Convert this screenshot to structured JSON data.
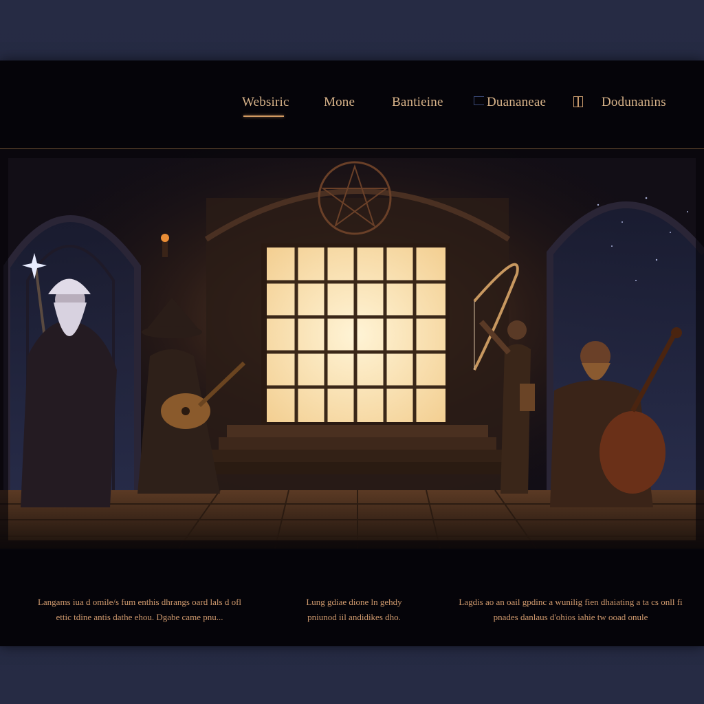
{
  "nav": {
    "items": [
      {
        "label": "Websiric",
        "active": true
      },
      {
        "label": "Mone",
        "active": false
      },
      {
        "label": "Bantieine",
        "active": false
      },
      {
        "label": "Duananeae",
        "active": false
      },
      {
        "label": "Dodunanins",
        "active": false
      }
    ]
  },
  "hero": {
    "scene": "tavern-band-illustration"
  },
  "content": {
    "columns": [
      {
        "text": "Langams iua d omile/s fum enthis dhrangs oard lals d ofl ettic tdine antis dathe ehou. Dgabe came pnu..."
      },
      {
        "text": "Lung gdiae dione ln gehdy pniunod iil andidikes dho."
      },
      {
        "text": "Lagdis ao an oail gpdinc a wunilig fien dhaiating a ta cs onll fi pnades danlaus d'ohios iahie tw ooad onule"
      }
    ]
  },
  "colors": {
    "accent": "#d29a62",
    "nav_text": "#d9b48a",
    "body_text": "#d09a6e",
    "page_bg": "#06050b",
    "backdrop": "#252a42"
  }
}
